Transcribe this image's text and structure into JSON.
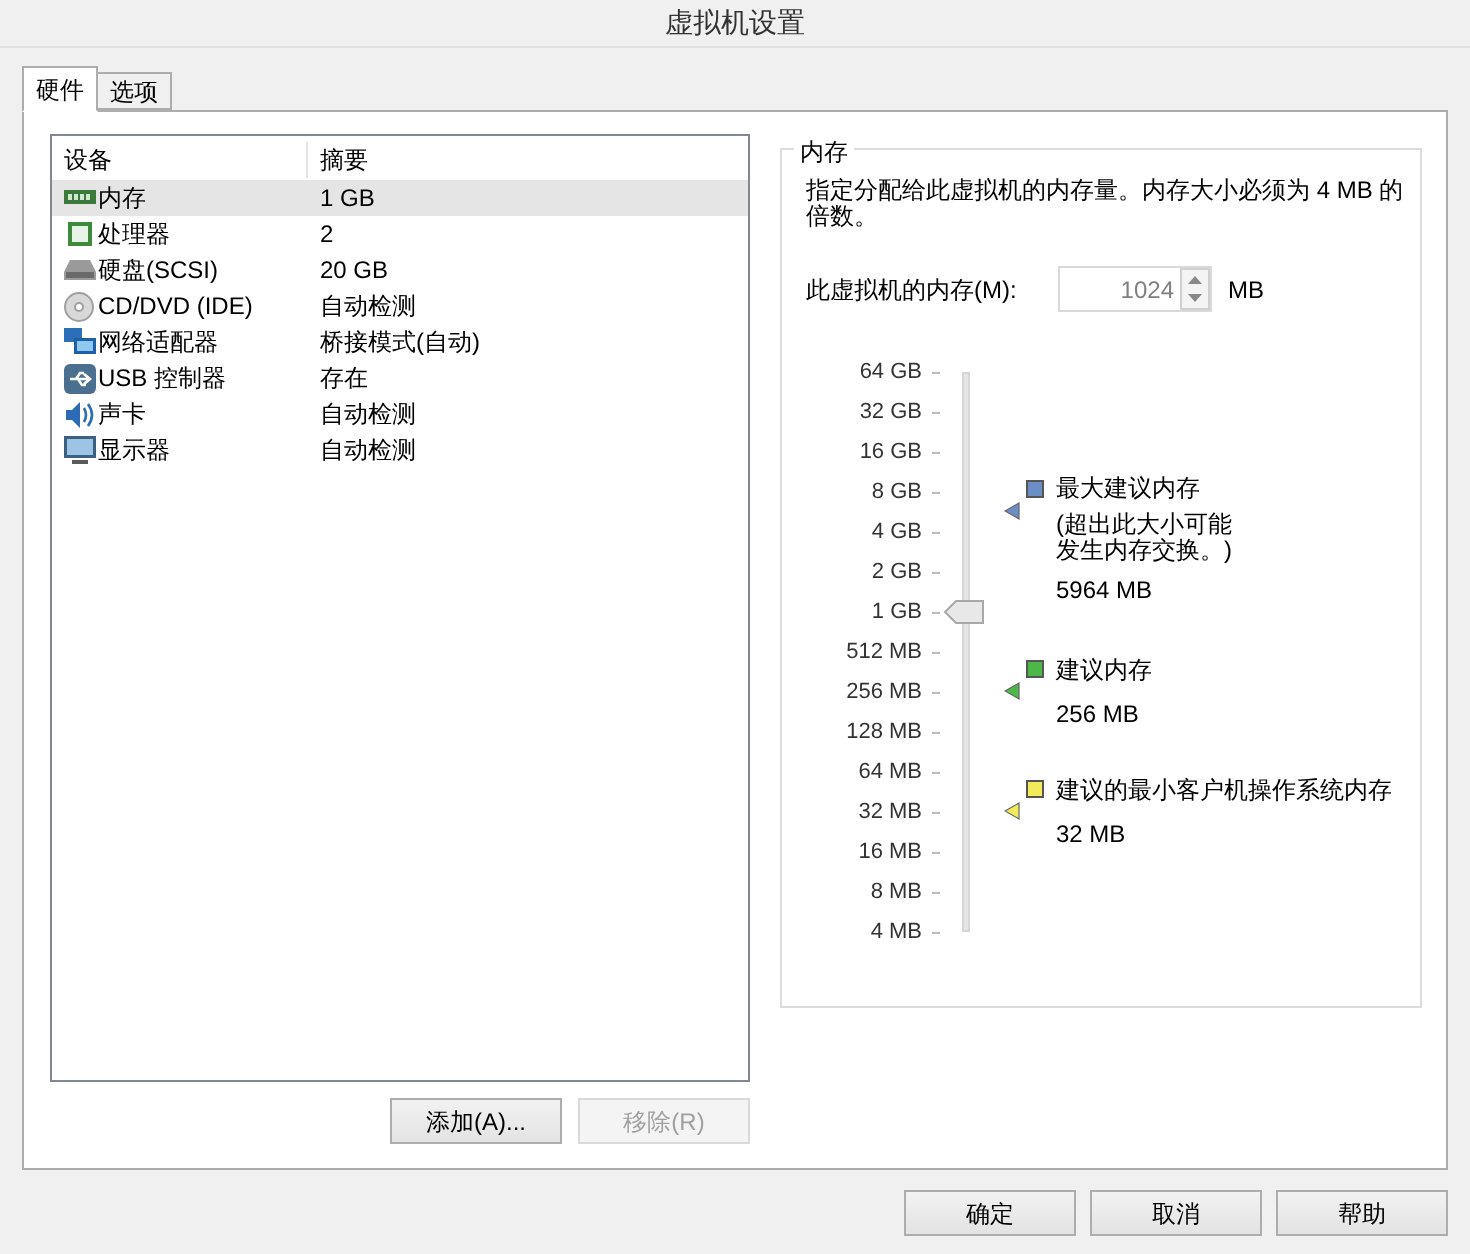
{
  "window": {
    "title": "虚拟机设置"
  },
  "tabs": [
    {
      "label": "硬件",
      "selected": true
    },
    {
      "label": "选项",
      "selected": false
    }
  ],
  "device_list": {
    "columns": [
      "设备",
      "摘要"
    ],
    "rows": [
      {
        "device": "内存",
        "summary": "1 GB",
        "selected": true
      },
      {
        "device": "处理器",
        "summary": "2",
        "selected": false
      },
      {
        "device": "硬盘(SCSI)",
        "summary": "20 GB",
        "selected": false
      },
      {
        "device": "CD/DVD (IDE)",
        "summary": "自动检测",
        "selected": false
      },
      {
        "device": "网络适配器",
        "summary": "桥接模式(自动)",
        "selected": false
      },
      {
        "device": "USB 控制器",
        "summary": "存在",
        "selected": false
      },
      {
        "device": "声卡",
        "summary": "自动检测",
        "selected": false
      },
      {
        "device": "显示器",
        "summary": "自动检测",
        "selected": false
      }
    ]
  },
  "list_buttons": [
    {
      "label": "添加(A)...",
      "disabled": false
    },
    {
      "label": "移除(R)",
      "disabled": true
    }
  ],
  "memory": {
    "title": "内存",
    "description": "指定分配给此虚拟机的内存量。内存大小必须为 4 MB 的倍数。",
    "field_label": "此虚拟机的内存(M):",
    "value": "1024",
    "unit": "MB",
    "slider": {
      "ticks": [
        "64 GB",
        "32 GB",
        "16 GB",
        "8 GB",
        "4 GB",
        "2 GB",
        "1 GB",
        "512 MB",
        "256 MB",
        "128 MB",
        "64 MB",
        "32 MB",
        "16 MB",
        "8 MB",
        "4 MB"
      ],
      "level": 0.571
    },
    "markers": [
      {
        "title": "最大建议内存",
        "note_lines": [
          "(超出此大小可能",
          "发生内存交换。)"
        ],
        "value": "5964 MB",
        "color": "#6b8fc4",
        "level": 0.753
      },
      {
        "title": "建议内存",
        "value": "256 MB",
        "color": "#4cb848",
        "level": 0.4286
      },
      {
        "title": "建议的最小客户机操作系统内存",
        "value": "32 MB",
        "color": "#f2ec5a",
        "level": 0.2143
      }
    ]
  },
  "dialog_buttons": [
    "确定",
    "取消",
    "帮助"
  ]
}
